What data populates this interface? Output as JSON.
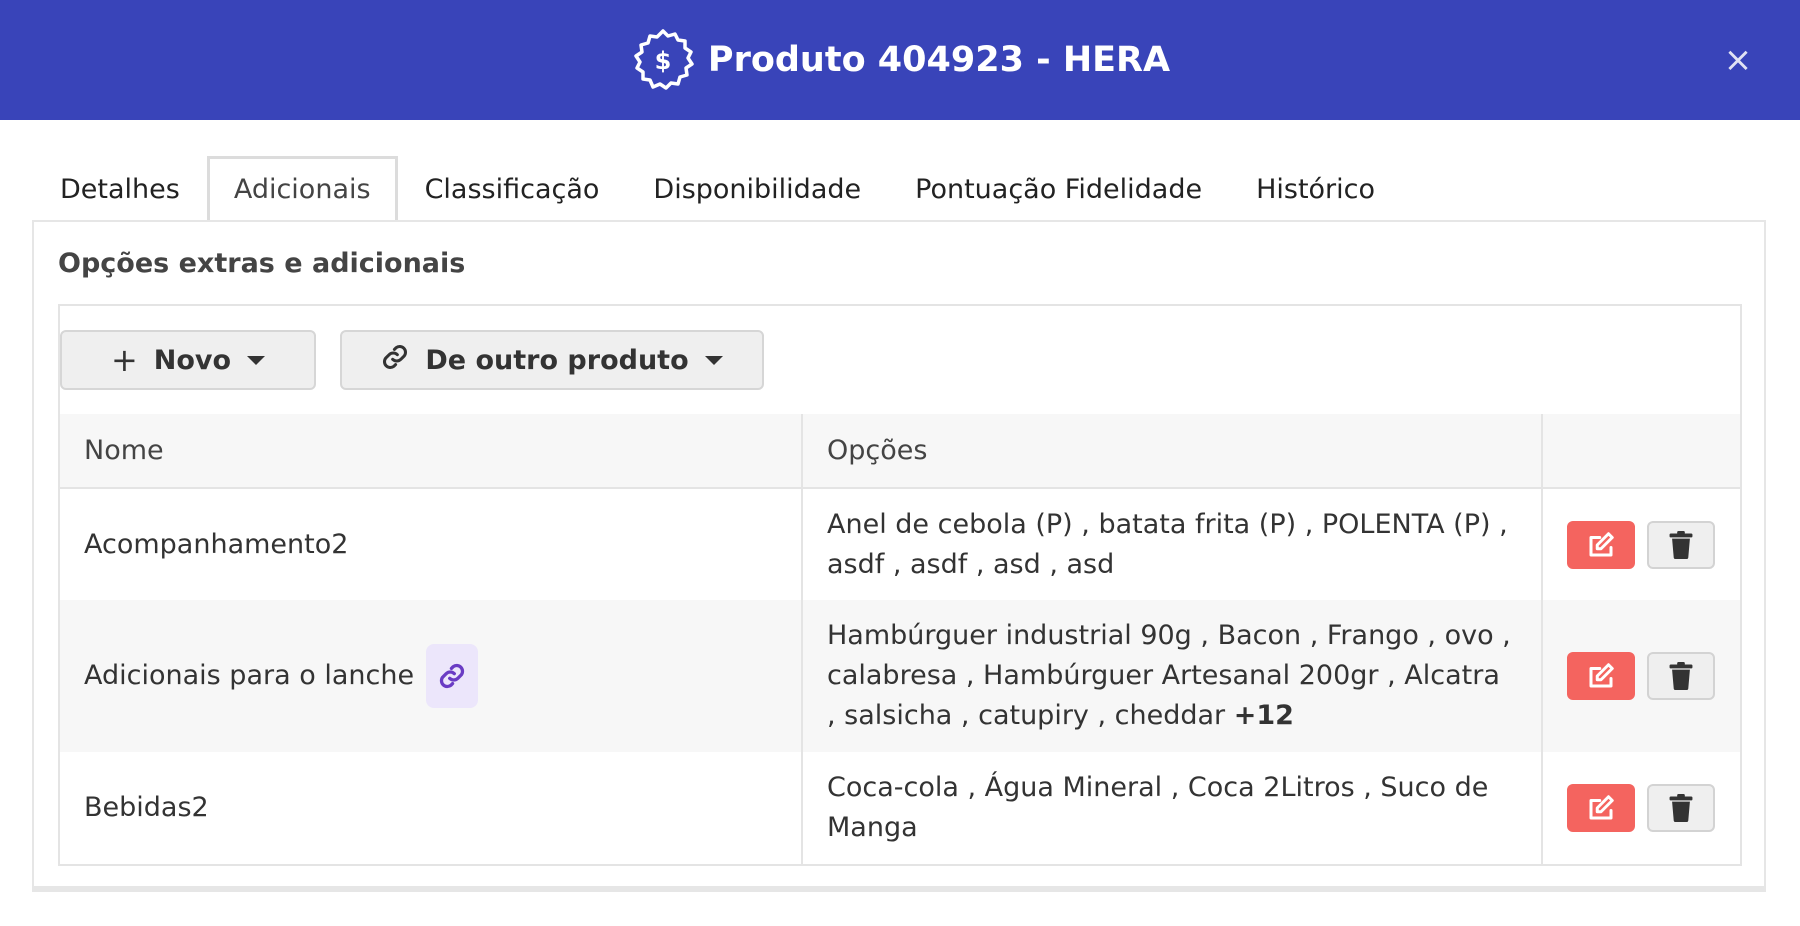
{
  "header": {
    "title": "Produto 404923 - HERA",
    "icon": "dollar-badge-icon",
    "close_label": "×",
    "bg_color": "#3944b9"
  },
  "tabs": [
    {
      "label": "Detalhes"
    },
    {
      "label": "Adicionais",
      "active": true
    },
    {
      "label": "Classificação"
    },
    {
      "label": "Disponibilidade"
    },
    {
      "label": "Pontuação Fidelidade"
    },
    {
      "label": "Histórico"
    }
  ],
  "panel": {
    "title": "Opções extras e adicionais"
  },
  "toolbar": {
    "new_label": "Novo",
    "from_other_label": "De outro produto"
  },
  "table": {
    "headers": [
      "Nome",
      "Opções",
      ""
    ],
    "rows": [
      {
        "name": "Acompanhamento2",
        "options": "Anel de cebola (P) , batata frita (P) , POLENTA (P) , asdf , asdf , asd , asd",
        "more": ""
      },
      {
        "name": "Adicionais para o lanche",
        "linked": true,
        "options": "Hambúrguer industrial 90g , Bacon , Frango , ovo , calabresa , Hambúrguer Artesanal 200gr , Alcatra , salsicha , catupiry , cheddar ",
        "more": "+12"
      },
      {
        "name": "Bebidas2",
        "options": "Coca-cola , Água Mineral , Coca 2Litros , Suco de Manga",
        "more": ""
      }
    ]
  },
  "colors": {
    "edit_button": "#f4645f",
    "link_badge_bg": "#ece6fb",
    "link_icon": "#6a3cc4"
  }
}
